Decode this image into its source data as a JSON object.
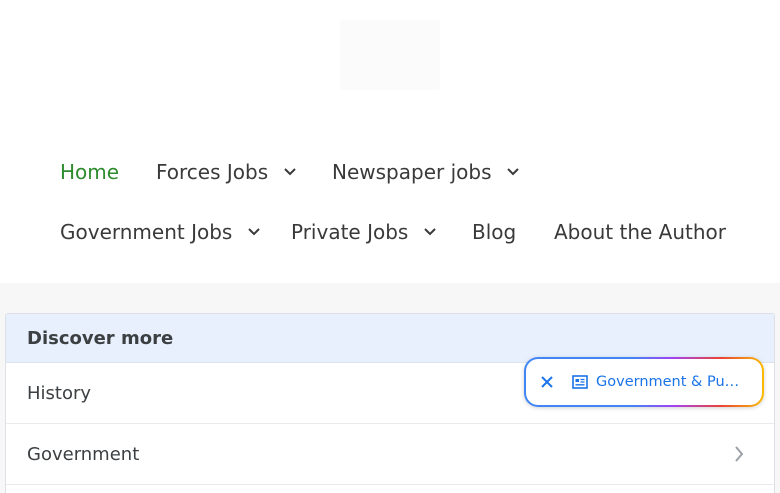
{
  "nav": {
    "items": [
      {
        "label": "Home",
        "active": true
      },
      {
        "label": "Forces Jobs",
        "has_dropdown": true
      },
      {
        "label": "Newspaper jobs",
        "has_dropdown": true
      },
      {
        "label": "Government Jobs",
        "has_dropdown": true
      },
      {
        "label": "Private Jobs",
        "has_dropdown": true
      },
      {
        "label": "Blog"
      },
      {
        "label": "About the Author"
      }
    ],
    "active_color": "#2e8b2e",
    "text_color": "#3a3a3a"
  },
  "discover": {
    "title": "Discover more",
    "rows": [
      {
        "label": "History"
      },
      {
        "label": "Government"
      }
    ],
    "header_bg": "#e8f0fe"
  },
  "pill": {
    "label": "Government & Publ...",
    "accent": "#1a73e8",
    "close_icon": "close-icon",
    "icon": "news-article-icon"
  }
}
